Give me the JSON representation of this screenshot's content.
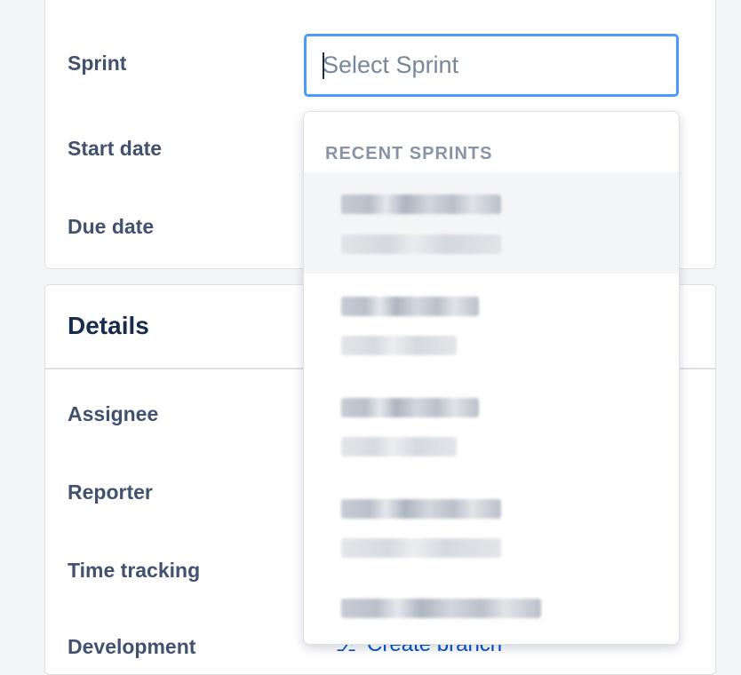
{
  "fields_top": {
    "sprint_label": "Sprint",
    "start_date_label": "Start date",
    "due_date_label": "Due date"
  },
  "sprint_input": {
    "placeholder": "Select Sprint",
    "value": ""
  },
  "dropdown": {
    "group_heading": "RECENT SPRINTS",
    "options_count_visible": 5,
    "highlighted_index": 0
  },
  "details": {
    "title": "Details",
    "assignee_label": "Assignee",
    "reporter_label": "Reporter",
    "time_tracking_label": "Time tracking",
    "development_label": "Development",
    "create_branch_text": "Create branch",
    "branch_icon": "branch-icon"
  },
  "colors": {
    "focus_border": "#4c9aff",
    "link": "#0052cc",
    "label": "#42526e",
    "heading": "#172b4d"
  }
}
